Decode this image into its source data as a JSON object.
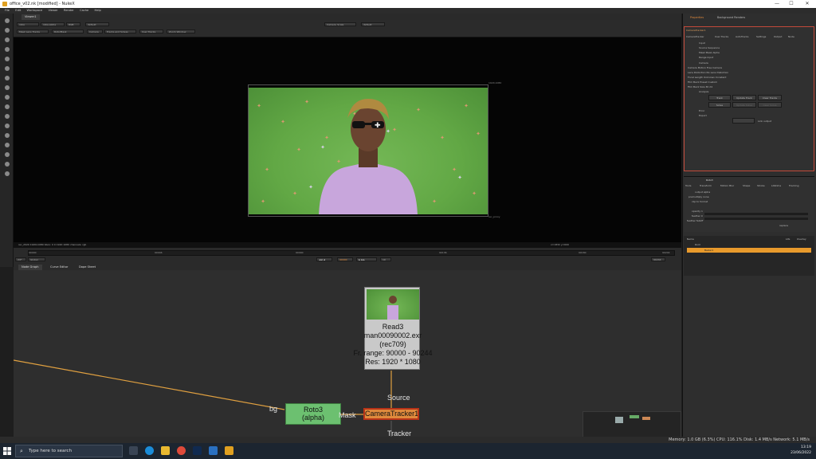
{
  "window": {
    "title": "office_v02.nk [modified] - NukeX",
    "controls": [
      "—",
      "☐",
      "✕"
    ]
  },
  "menu": [
    "File",
    "Edit",
    "Workspace",
    "Viewer",
    "Render",
    "Cache",
    "Help"
  ],
  "viewer": {
    "tab": "Viewer1",
    "toolbar": [
      "rgba",
      "rgba.alpha",
      "RGB",
      "default",
      "Camera_Scale",
      "default"
    ],
    "mask_bar": [
      "Mask Lens Tracks",
      "Roto/Mask",
      "Camera",
      "Tracks and Solves",
      "User Tracks",
      "Zoom Window"
    ],
    "info_left": "rec_2020 1920x1080 bbox: 0 0 1920 1080 channels: rgb",
    "info_right": "x=1832 y=600",
    "format_label_top": "1920,1080",
    "format_label_bottom": "rec_proxy"
  },
  "timeline": {
    "frame": "90000",
    "fps": "24*",
    "mode": "Global",
    "ticks": [
      "90000",
      "90046",
      "90090",
      "90136",
      "90180",
      "90225",
      "90244"
    ],
    "end": "90244",
    "step": "10"
  },
  "node_graph_tabs": [
    "Node Graph",
    "Curve Editor",
    "Dope Sheet"
  ],
  "nodes": {
    "read3": {
      "name": "Read3",
      "file": "man00090002.exr",
      "colorspace": "(rec709)",
      "range": "Fr. range: 90000 - 90244",
      "res": "Res: 1920 * 1080"
    },
    "roto3": {
      "name": "Roto3",
      "sub": "(alpha)"
    },
    "camera_tracker": {
      "name": "CameraTracker1"
    },
    "labels": {
      "bg": "bg",
      "mask": "Mask",
      "source": "Source",
      "tracker": "Tracker"
    }
  },
  "properties": {
    "tabs": [
      "Properties",
      "Background Renders"
    ],
    "node_name": "CameraTracker1",
    "subtabs": [
      "CameraTracker",
      "User Tracks",
      "AutoTracks",
      "Settings",
      "Output",
      "Node"
    ],
    "rows": [
      "Input",
      "Source Sequence",
      "Mask Mask Alpha",
      "Range Input",
      "Camera",
      "Camera Motion Free Camera",
      "Lens Distortion No Lens Distortion",
      "Focal Length Unknown Constant",
      "Film Back Preset Custom",
      "Film Back Size 36 24",
      "Analysis"
    ],
    "buttons": [
      "Track",
      "Update Track",
      "Clear Tracks",
      "Solve",
      "Update Solve",
      "Clear Solve"
    ],
    "error_label": "Error",
    "export_label": "Export",
    "link_label": "Link output"
  },
  "roto_panel": {
    "title": "Roto3",
    "tabs": [
      "Tools",
      "Transform",
      "Motion Blur",
      "Shape",
      "Stroke",
      "Lifetime",
      "Tracking"
    ],
    "rows": [
      "output alpha",
      "premultiply none",
      "clip to format",
      "opacity 1",
      "feather 0",
      "feather falloff",
      "replace"
    ],
    "layer_header": [
      "Name",
      "Life",
      "Overlay"
    ],
    "layer_root": "Root",
    "layer_item": "Bezier1"
  },
  "status": {
    "text": "Memory: 1.0 GB (6.3%) CPU: 116.1% Disk: 1.4 MB/s Network: 5.1 MB/s"
  },
  "taskbar": {
    "search_placeholder": "Type here to search",
    "time": "13:19",
    "date": "23/06/2022"
  }
}
